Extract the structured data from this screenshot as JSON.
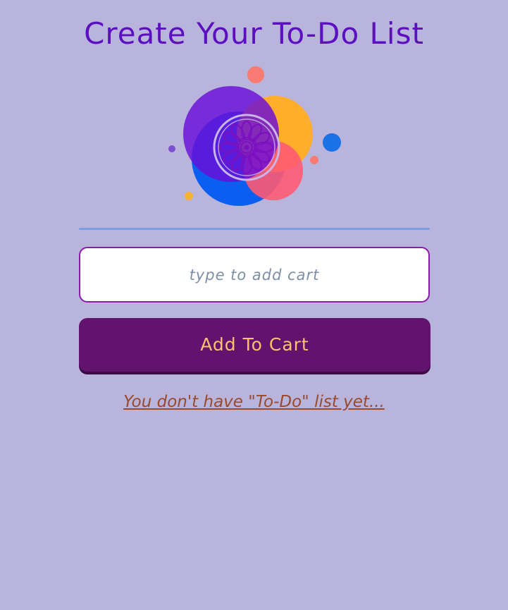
{
  "header": {
    "title": "Create Your To-Do List"
  },
  "logo": {
    "icon": "mandala-logo-icon",
    "colors": [
      "#6a0dd8",
      "#0a5ef0",
      "#ffad2a",
      "#ff5a72",
      "#f87a70",
      "#1a72e6"
    ]
  },
  "form": {
    "input_placeholder": "type to add cart",
    "input_value": "",
    "button_label": "Add To Cart"
  },
  "list": {
    "empty_message": "You don't have \"To-Do\" list yet..."
  },
  "colors": {
    "background": "#b8b4dc",
    "title": "#5c0fc0",
    "button_bg": "#62136e",
    "button_text": "#ffc070",
    "empty_text": "#9a4a2c",
    "divider": "#7f9ee0"
  }
}
